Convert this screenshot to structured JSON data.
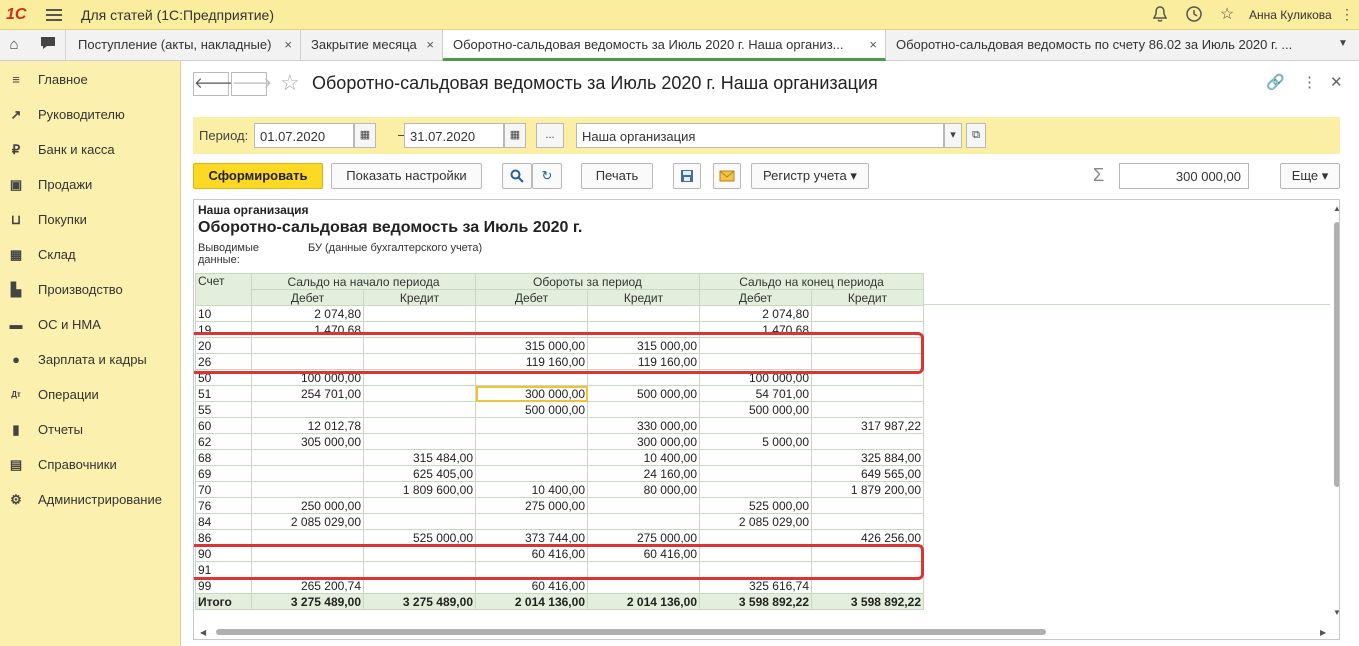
{
  "app": {
    "logo": "1С",
    "title": "Для статей  (1С:Предприятие)",
    "user": "Анна Куликова"
  },
  "tabs": [
    {
      "label": "Поступление (акты, накладные)"
    },
    {
      "label": "Закрытие месяца"
    },
    {
      "label": "Оборотно-сальдовая ведомость за Июль 2020 г. Наша организ..."
    },
    {
      "label": "Оборотно-сальдовая ведомость по счету 86.02 за Июль 2020 г. ..."
    }
  ],
  "sidebar": {
    "items": [
      {
        "label": "Главное",
        "icon": "≡"
      },
      {
        "label": "Руководителю",
        "icon": "↗"
      },
      {
        "label": "Банк и касса",
        "icon": "₽"
      },
      {
        "label": "Продажи",
        "icon": "▣"
      },
      {
        "label": "Покупки",
        "icon": "⊔"
      },
      {
        "label": "Склад",
        "icon": "▦"
      },
      {
        "label": "Производство",
        "icon": "▙"
      },
      {
        "label": "ОС и НМА",
        "icon": "▬"
      },
      {
        "label": "Зарплата и кадры",
        "icon": "●"
      },
      {
        "label": "Операции",
        "icon": "Дт"
      },
      {
        "label": "Отчеты",
        "icon": "▮"
      },
      {
        "label": "Справочники",
        "icon": "▤"
      },
      {
        "label": "Администрирование",
        "icon": "⚙"
      }
    ]
  },
  "document": {
    "title": "Оборотно-сальдовая ведомость за Июль 2020 г. Наша организация"
  },
  "params": {
    "period_label": "Период:",
    "date_from": "01.07.2020",
    "dash": "–",
    "date_to": "31.07.2020",
    "dots": "...",
    "organization": "Наша организация"
  },
  "toolbar": {
    "generate": "Сформировать",
    "show_settings": "Показать настройки",
    "print": "Печать",
    "register": "Регистр учета",
    "sum_value": "300 000,00",
    "more": "Еще"
  },
  "report": {
    "org": "Наша организация",
    "title": "Оборотно-сальдовая ведомость за Июль 2020 г.",
    "output_label": "Выводимые данные:",
    "output_value": "БУ (данные бухгалтерского учета)",
    "headers": {
      "account": "Счет",
      "opening": "Сальдо на начало периода",
      "turnover": "Обороты за период",
      "closing": "Сальдо на конец периода",
      "debit": "Дебет",
      "credit": "Кредит"
    },
    "rows": [
      [
        "10",
        "2 074,80",
        "",
        "",
        "",
        "2 074,80",
        ""
      ],
      [
        "19",
        "1 470,68",
        "",
        "",
        "",
        "1 470,68",
        ""
      ],
      [
        "20",
        "",
        "",
        "315 000,00",
        "315 000,00",
        "",
        ""
      ],
      [
        "26",
        "",
        "",
        "119 160,00",
        "119 160,00",
        "",
        ""
      ],
      [
        "50",
        "100 000,00",
        "",
        "",
        "",
        "100 000,00",
        ""
      ],
      [
        "51",
        "254 701,00",
        "",
        "300 000,00",
        "500 000,00",
        "54 701,00",
        ""
      ],
      [
        "55",
        "",
        "",
        "500 000,00",
        "",
        "500 000,00",
        ""
      ],
      [
        "60",
        "12 012,78",
        "",
        "",
        "330 000,00",
        "",
        "317 987,22"
      ],
      [
        "62",
        "305 000,00",
        "",
        "",
        "300 000,00",
        "5 000,00",
        ""
      ],
      [
        "68",
        "",
        "315 484,00",
        "",
        "10 400,00",
        "",
        "325 884,00"
      ],
      [
        "69",
        "",
        "625 405,00",
        "",
        "24 160,00",
        "",
        "649 565,00"
      ],
      [
        "70",
        "",
        "1 809 600,00",
        "10 400,00",
        "80 000,00",
        "",
        "1 879 200,00"
      ],
      [
        "76",
        "250 000,00",
        "",
        "275 000,00",
        "",
        "525 000,00",
        ""
      ],
      [
        "84",
        "2 085 029,00",
        "",
        "",
        "",
        "2 085 029,00",
        ""
      ],
      [
        "86",
        "",
        "525 000,00",
        "373 744,00",
        "275 000,00",
        "",
        "426 256,00"
      ],
      [
        "90",
        "",
        "",
        "60 416,00",
        "60 416,00",
        "",
        ""
      ],
      [
        "91",
        "",
        "",
        "",
        "",
        "",
        ""
      ],
      [
        "99",
        "265 200,74",
        "",
        "60 416,00",
        "",
        "325 616,74",
        ""
      ]
    ],
    "total": [
      "Итого",
      "3 275 489,00",
      "3 275 489,00",
      "2 014 136,00",
      "2 014 136,00",
      "3 598 892,22",
      "3 598 892,22"
    ]
  }
}
